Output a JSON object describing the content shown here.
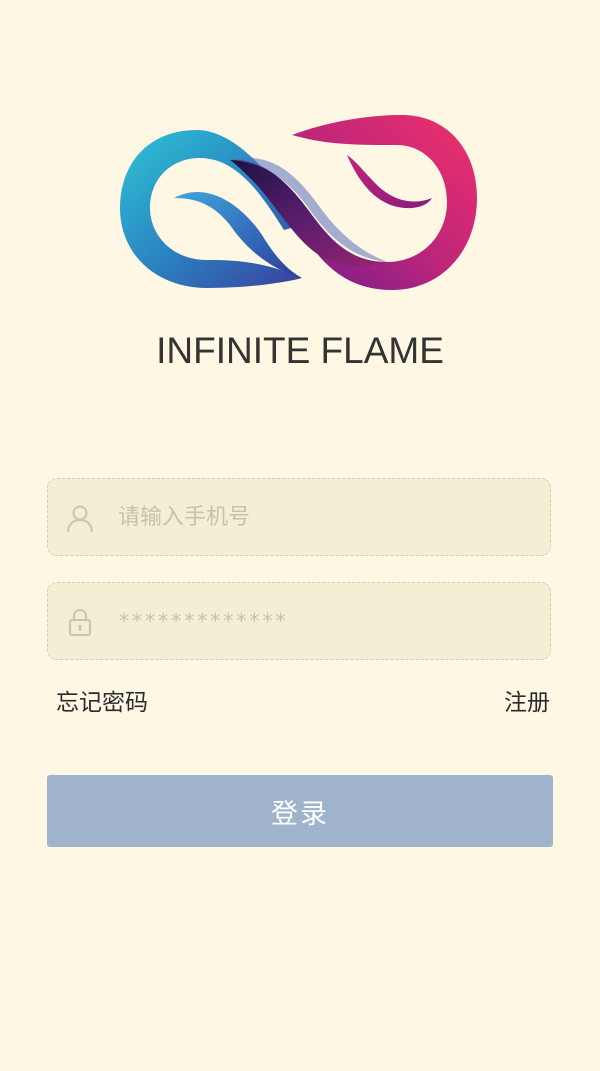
{
  "app": {
    "brand_name": "INFINITE FLAME",
    "logo_icon": "infinity-flame-logo"
  },
  "login_form": {
    "phone_field": {
      "icon": "user-icon",
      "placeholder": "请输入手机号",
      "value": ""
    },
    "password_field": {
      "icon": "lock-icon",
      "value": "*************"
    },
    "forgot_password_label": "忘记密码",
    "register_label": "注册",
    "login_button_label": "登录"
  },
  "colors": {
    "background": "#fdf7e3",
    "field_background": "#f4eed5",
    "login_button": "#9fb3cc",
    "logo_left_gradient": [
      "#2ec4d6",
      "#3b3f9e"
    ],
    "logo_right_gradient": [
      "#f0306a",
      "#7a1a8c"
    ]
  }
}
